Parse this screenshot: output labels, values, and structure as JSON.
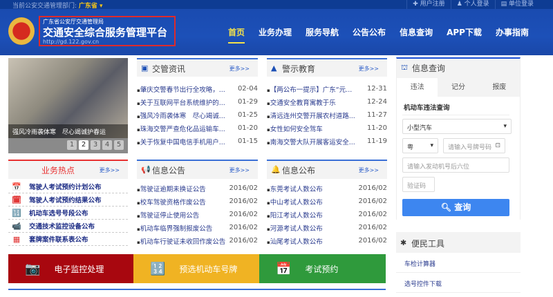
{
  "topbar": {
    "dept_label": "当前公安交通管理部门:",
    "province": "广东省 ▾",
    "links": [
      "✚ 用户注册",
      "♟ 个人登录",
      "▤ 单位登录"
    ]
  },
  "header": {
    "org": "广东省公安厅交通管理局",
    "title": "交通安全综合服务管理平台",
    "url": "http://gd.122.gov.cn"
  },
  "nav": [
    "首页",
    "业务办理",
    "服务导航",
    "公告公布",
    "信息查询",
    "APP下载",
    "办事指南"
  ],
  "slider": {
    "caption": "强风冷雨袭体寒　尽心竭诚护春运",
    "pages": [
      "1",
      "2",
      "3",
      "4",
      "5"
    ],
    "current": 2
  },
  "more": "更多>>",
  "news": {
    "title": "交管资讯",
    "items": [
      [
        "肇庆交警春节出行全攻略，...",
        "02-04"
      ],
      [
        "关于互联网平台系统维护的...",
        "01-29"
      ],
      [
        "强风冷雨袭体寒　尽心竭诚...",
        "01-25"
      ],
      [
        "珠海交警严查危化品运输车...",
        "01-20"
      ],
      [
        "关于恢复中国电信手机用户...",
        "01-15"
      ]
    ]
  },
  "warn": {
    "title": "警示教育",
    "items": [
      [
        "【两公布一提示】广东“元...",
        "12-31"
      ],
      [
        "交通安全教育寓教于乐",
        "12-24"
      ],
      [
        "清远连州交警开展农村道路...",
        "11-27"
      ],
      [
        "女性如何安全驾车",
        "11-20"
      ],
      [
        "南海交警大队开展客运安全...",
        "11-19"
      ]
    ]
  },
  "hot": {
    "title": "业务热点",
    "items": [
      "驾驶人考试预约计划公布",
      "驾驶人考试预约结果公布",
      "机动车选号号段公布",
      "交通技术监控设备公布",
      "套牌案件联系表公布"
    ]
  },
  "notice": {
    "title": "信息公告",
    "items": [
      [
        "驾驶证逾期未换证公告",
        "2016/02"
      ],
      [
        "校车驾驶资格作废公告",
        "2016/02"
      ],
      [
        "驾驶证停止使用公告",
        "2016/02"
      ],
      [
        "机动车临界强制报废公告",
        "2016/02"
      ],
      [
        "机动车行驶证未收回作废公告",
        "2016/02"
      ]
    ]
  },
  "publish": {
    "title": "信息公布",
    "items": [
      [
        "东莞考试人数公布",
        "2016/02"
      ],
      [
        "中山考试人数公布",
        "2016/02"
      ],
      [
        "阳江考试人数公布",
        "2016/02"
      ],
      [
        "河源考试人数公布",
        "2016/02"
      ],
      [
        "汕尾考试人数公布",
        "2016/02"
      ]
    ]
  },
  "banners": [
    {
      "label": "电子监控处理",
      "color": "#a8070f"
    },
    {
      "label": "预选机动车号牌",
      "color": "#f0b323"
    },
    {
      "label": "考试预约",
      "color": "#2f9a3c"
    }
  ],
  "query": {
    "title": "信息查询",
    "tabs": [
      "违法",
      "记分",
      "报废"
    ],
    "form_title": "机动车违法查询",
    "vehicle_type": "小型汽车",
    "province": "粤",
    "plate_placeholder": "请输入号牌号码",
    "engine_placeholder": "请输入发动机号后六位",
    "captcha_placeholder": "验证码",
    "submit": "查询"
  },
  "tools": {
    "title": "便民工具",
    "items": [
      "车检计算器",
      "选号控件下载"
    ]
  }
}
